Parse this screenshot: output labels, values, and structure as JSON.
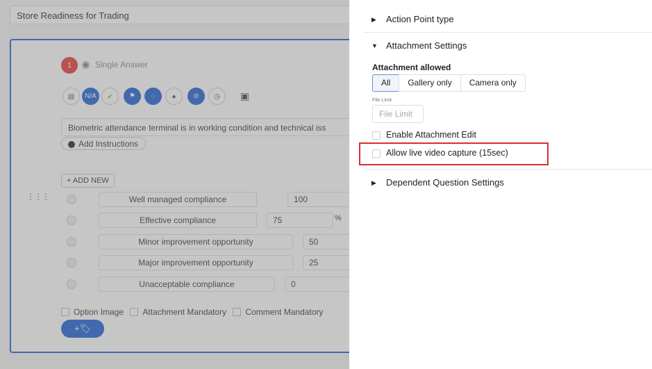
{
  "left": {
    "title": "Store Readiness for Trading",
    "question_number": "1",
    "question_type": "Single Answer",
    "toolbar": [
      {
        "icon": "file-plus-icon",
        "glyph": "▤"
      },
      {
        "icon": "na-icon",
        "glyph": "N/A"
      },
      {
        "icon": "check-icon",
        "glyph": "✓"
      },
      {
        "icon": "flag-icon",
        "glyph": "⚑"
      },
      {
        "icon": "chat-icon",
        "glyph": "◌"
      },
      {
        "icon": "comment-icon",
        "glyph": "●"
      },
      {
        "icon": "paperclip-icon",
        "glyph": "⊘"
      },
      {
        "icon": "clock-icon",
        "glyph": "◷"
      },
      {
        "icon": "messages-icon",
        "glyph": "▣"
      }
    ],
    "question_text": "Biometric attendance terminal is in working condition and technical iss",
    "add_instructions": "Add Instructions",
    "add_new": "+ ADD NEW",
    "options": [
      {
        "label": "Well managed compliance",
        "score": "100"
      },
      {
        "label": "Effective compliance",
        "score": "75"
      },
      {
        "label": "Minor improvement opportunity",
        "score": "50"
      },
      {
        "label": "Major improvement opportunity",
        "score": "25"
      },
      {
        "label": "Unacceptable compliance",
        "score": "0"
      }
    ],
    "percent_sign": "%",
    "option_image": "Option Image",
    "attachment_mandatory": "Attachment Mandatory",
    "comment_mandatory": "Comment Mandatory",
    "tag_button": "+🏷"
  },
  "drawer": {
    "action_point_type": "Action Point type",
    "attachment_settings": "Attachment Settings",
    "attachment_allowed_label": "Attachment allowed",
    "attachment_options": [
      "All",
      "Gallery only",
      "Camera only"
    ],
    "selected_attachment_option": "All",
    "file_limit_small_label": "File Limit",
    "file_limit_placeholder": "File Limit",
    "enable_attachment_edit": "Enable Attachment Edit",
    "allow_live_video": "Allow live video capture (15sec)",
    "dependent_question_settings": "Dependent Question Settings"
  },
  "colors": {
    "accent": "#1d5fd6",
    "highlight": "#d32f2f",
    "question_badge": "#e53935"
  }
}
